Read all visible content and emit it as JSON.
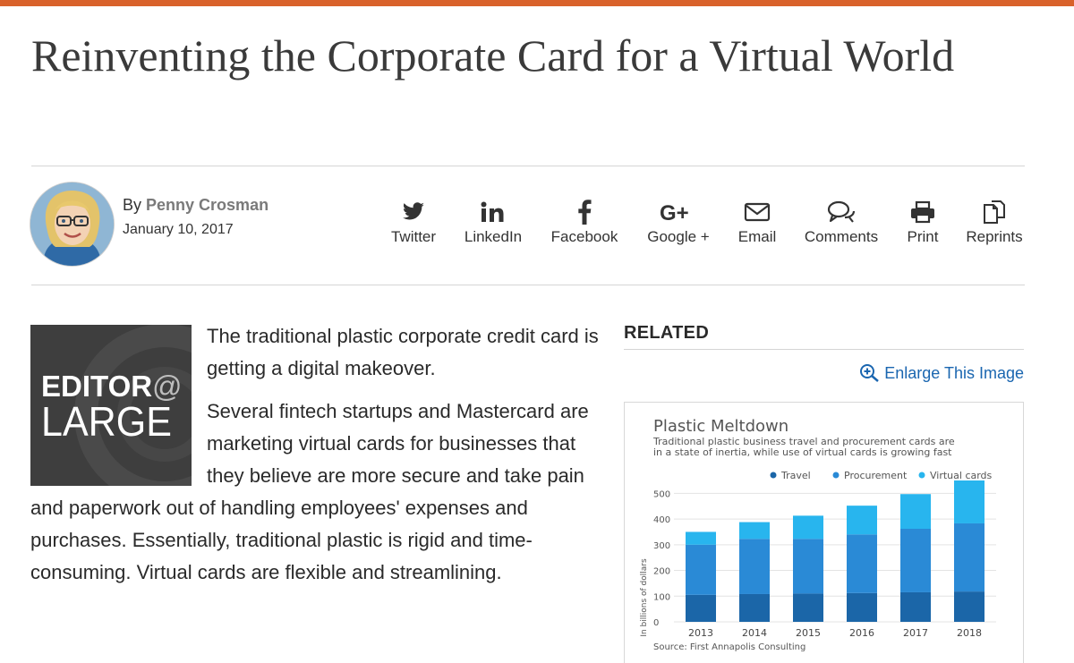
{
  "article": {
    "title": "Reinventing the Corporate Card for a Virtual World",
    "byline_prefix": "By",
    "author": "Penny Crosman",
    "date": "January 10, 2017",
    "paragraphs": [
      "The traditional plastic corporate credit card is getting a digital makeover.",
      "Several fintech startups and Mastercard are marketing virtual cards for businesses that they believe are more secure and take pain and paperwork out of handling employees' expenses and purchases. Essentially, traditional plastic is rigid and time-consuming. Virtual cards are flexible and streamlining."
    ],
    "badge": {
      "line1": "EDITOR",
      "at": "@",
      "line2": "LARGE"
    }
  },
  "share": [
    {
      "label": "Twitter",
      "icon": "twitter-icon"
    },
    {
      "label": "LinkedIn",
      "icon": "linkedin-icon"
    },
    {
      "label": "Facebook",
      "icon": "facebook-icon"
    },
    {
      "label": "Google +",
      "icon": "google-plus-icon"
    },
    {
      "label": "Email",
      "icon": "email-icon"
    },
    {
      "label": "Comments",
      "icon": "comments-icon"
    },
    {
      "label": "Print",
      "icon": "print-icon"
    },
    {
      "label": "Reprints",
      "icon": "reprints-icon"
    }
  ],
  "related": {
    "heading": "RELATED",
    "enlarge_label": "Enlarge This Image"
  },
  "colors": {
    "accent_bar": "#d9622b",
    "link": "#1a66b0",
    "travel": "#1b66a8",
    "procurement": "#2a8ad6",
    "virtual": "#28b5ee"
  },
  "chart_data": {
    "type": "bar",
    "stacked": true,
    "title": "Plastic Meltdown",
    "subtitle_lines": [
      "Traditional plastic business travel and procurement cards are",
      "in a state of inertia, while use of virtual cards is growing fast"
    ],
    "ylabel": "In billions of dollars",
    "source": "Source: First Annapolis Consulting",
    "categories": [
      "2013",
      "2014",
      "2015",
      "2016",
      "2017",
      "2018"
    ],
    "ylim": [
      0,
      550
    ],
    "yticks": [
      0,
      100,
      200,
      300,
      400,
      500
    ],
    "grid": true,
    "legend_position": "top-right",
    "series": [
      {
        "name": "Travel",
        "color": "#1b66a8",
        "values": [
          105,
          108,
          110,
          112,
          115,
          118
        ]
      },
      {
        "name": "Procurement",
        "color": "#2a8ad6",
        "values": [
          195,
          215,
          213,
          228,
          247,
          265
        ]
      },
      {
        "name": "Virtual cards",
        "color": "#28b5ee",
        "values": [
          50,
          65,
          90,
          112,
          135,
          167
        ]
      }
    ]
  }
}
